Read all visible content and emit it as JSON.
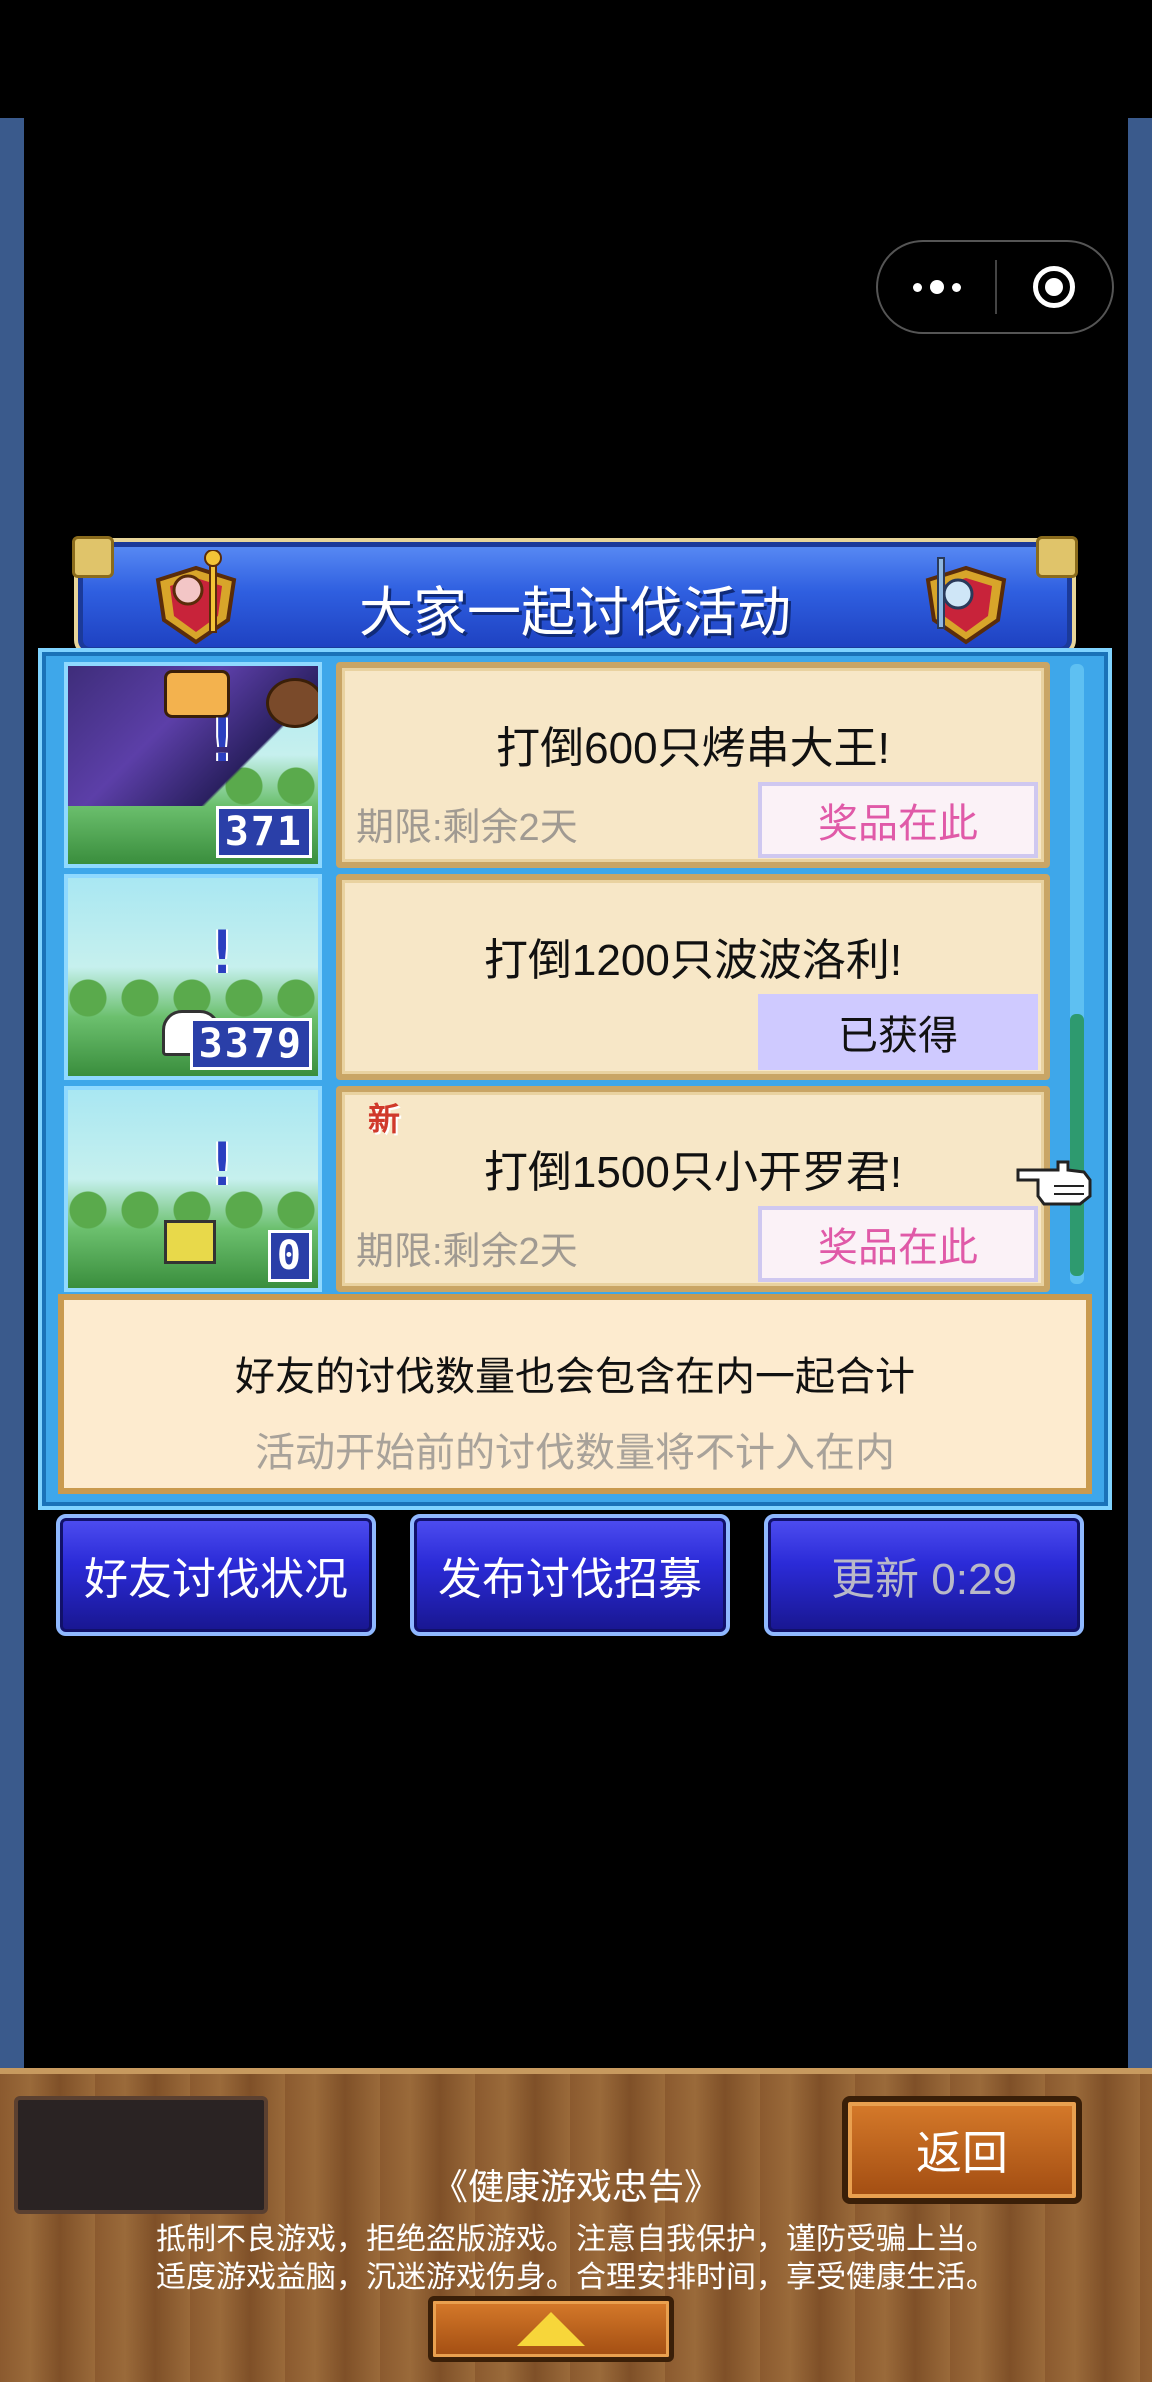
{
  "banner": {
    "title": "大家一起讨伐活动"
  },
  "missions": [
    {
      "title": "打倒600只烤串大王!",
      "limit": "期限:剩余2天",
      "reward": "奖品在此",
      "reward_state": "claim",
      "count": "371",
      "is_new": false
    },
    {
      "title": "打倒1200只波波洛利!",
      "limit": "",
      "reward": "已获得",
      "reward_state": "done",
      "count": "3379",
      "is_new": false
    },
    {
      "title": "打倒1500只小开罗君!",
      "limit": "期限:剩余2天",
      "reward": "奖品在此",
      "reward_state": "claim",
      "count": "0",
      "is_new": true,
      "new_label": "新"
    }
  ],
  "thumb_marker": "!",
  "info": {
    "line1": "好友的讨伐数量也会包含在内一起合计",
    "line2": "活动开始前的讨伐数量将不计入在内"
  },
  "buttons": {
    "friend_status": "好友讨伐状况",
    "recruit": "发布讨伐招募",
    "refresh": "更新 0:29"
  },
  "footer": {
    "back": "返回",
    "advice_title": "《健康游戏忠告》",
    "advice_line1": "抵制不良游戏，拒绝盗版游戏。注意自我保护，谨防受骗上当。",
    "advice_line2": "适度游戏益脑，沉迷游戏伤身。合理安排时间，享受健康生活。"
  },
  "icons": {
    "menu": "more-dots-icon",
    "close": "target-close-icon",
    "pointer": "hand-pointer-icon",
    "up": "up-arrow-icon"
  }
}
